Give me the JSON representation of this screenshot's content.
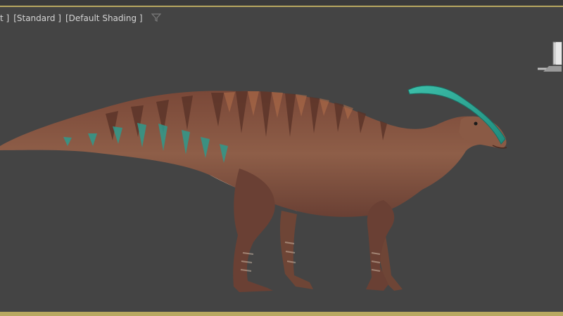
{
  "viewport": {
    "labels": {
      "view": "t ]",
      "mode": "[Standard ]",
      "shading": "[Default Shading ]"
    },
    "filter_icon": "filter-funnel-icon",
    "viewcube_icon": "viewcube-icon",
    "model": "parasaurolophus-model",
    "colors": {
      "background": "#444444",
      "frame_accent": "#b8a860",
      "skin": "#8a5a45",
      "crest": "#2fa896",
      "label_text": "#d4d4d4"
    }
  }
}
